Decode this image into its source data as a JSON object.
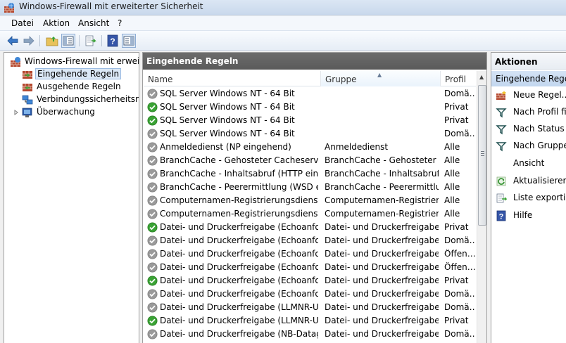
{
  "window": {
    "title": "Windows-Firewall mit erweiterter Sicherheit"
  },
  "menu": [
    "Datei",
    "Aktion",
    "Ansicht",
    "?"
  ],
  "toolbar": [
    "back-icon",
    "forward-icon",
    "up-folder-icon",
    "show-hide-tree-icon",
    "export-list-icon",
    "help-icon",
    "show-hide-action-pane-icon"
  ],
  "tree": {
    "root": "Windows-Firewall mit erweiterter Sicherheit",
    "items": [
      "Eingehende Regeln",
      "Ausgehende Regeln",
      "Verbindungssicherheitsregeln",
      "Überwachung"
    ]
  },
  "center": {
    "header": "Eingehende Regeln",
    "columns": [
      "Name",
      "Gruppe",
      "Profil"
    ],
    "rows": [
      {
        "name": "SQL Server Windows NT - 64 Bit",
        "group": "",
        "profile": "Domä…",
        "enabled": false
      },
      {
        "name": "SQL Server Windows NT - 64 Bit",
        "group": "",
        "profile": "Privat",
        "enabled": true
      },
      {
        "name": "SQL Server Windows NT - 64 Bit",
        "group": "",
        "profile": "Privat",
        "enabled": true
      },
      {
        "name": "SQL Server Windows NT - 64 Bit",
        "group": "",
        "profile": "Domä…",
        "enabled": false
      },
      {
        "name": "Anmeldedienst (NP eingehend)",
        "group": "Anmeldedienst",
        "profile": "Alle",
        "enabled": false
      },
      {
        "name": "BranchCache - Gehosteter Cacheserver (…",
        "group": "BranchCache - Gehosteter C…",
        "profile": "Alle",
        "enabled": false
      },
      {
        "name": "BranchCache - Inhaltsabruf (HTTP einge…",
        "group": "BranchCache - Inhaltsabruf …",
        "profile": "Alle",
        "enabled": false
      },
      {
        "name": "BranchCache - Peerermittlung (WSD ein…",
        "group": "BranchCache - Peerermittlu…",
        "profile": "Alle",
        "enabled": false
      },
      {
        "name": "Computernamen-Registrierungsdienst v…",
        "group": "Computernamen-Registrier…",
        "profile": "Alle",
        "enabled": false
      },
      {
        "name": "Computernamen-Registrierungsdienst v…",
        "group": "Computernamen-Registrier…",
        "profile": "Alle",
        "enabled": false
      },
      {
        "name": "Datei- und Druckerfreigabe (Echoanforde…",
        "group": "Datei- und Druckerfreigabe",
        "profile": "Privat",
        "enabled": true
      },
      {
        "name": "Datei- und Druckerfreigabe (Echoanforde…",
        "group": "Datei- und Druckerfreigabe",
        "profile": "Domä…",
        "enabled": false
      },
      {
        "name": "Datei- und Druckerfreigabe (Echoanforde…",
        "group": "Datei- und Druckerfreigabe",
        "profile": "Öffen…",
        "enabled": false
      },
      {
        "name": "Datei- und Druckerfreigabe (Echoanforde…",
        "group": "Datei- und Druckerfreigabe",
        "profile": "Öffen…",
        "enabled": false
      },
      {
        "name": "Datei- und Druckerfreigabe (Echoanforde…",
        "group": "Datei- und Druckerfreigabe",
        "profile": "Privat",
        "enabled": true
      },
      {
        "name": "Datei- und Druckerfreigabe (Echoanforde…",
        "group": "Datei- und Druckerfreigabe",
        "profile": "Domä…",
        "enabled": false
      },
      {
        "name": "Datei- und Druckerfreigabe (LLMNR-UDP…",
        "group": "Datei- und Druckerfreigabe",
        "profile": "Domä…",
        "enabled": false
      },
      {
        "name": "Datei- und Druckerfreigabe (LLMNR-UDP…",
        "group": "Datei- und Druckerfreigabe",
        "profile": "Privat",
        "enabled": true
      },
      {
        "name": "Datei- und Druckerfreigabe (NB-Datagra…",
        "group": "Datei- und Druckerfreigabe",
        "profile": "Domä…",
        "enabled": false
      }
    ]
  },
  "actions": {
    "header": "Aktionen",
    "section": "Eingehende Regeln",
    "items": [
      {
        "label": "Neue Regel...",
        "icon": "new-rule-icon"
      },
      {
        "label": "Nach Profil filtern",
        "icon": "filter-icon"
      },
      {
        "label": "Nach Status filtern",
        "icon": "filter-icon"
      },
      {
        "label": "Nach Gruppe filtern",
        "icon": "filter-icon"
      },
      {
        "label": "Ansicht",
        "icon": ""
      },
      {
        "label": "Aktualisieren",
        "icon": "refresh-icon"
      },
      {
        "label": "Liste exportieren...",
        "icon": "export-list-icon"
      },
      {
        "label": "Hilfe",
        "icon": "help-icon"
      }
    ]
  },
  "colors": {
    "enabled": "#3aa335",
    "disabled": "#9a9a9a",
    "header_dark": "#626262",
    "selection": "#dbe8f6"
  }
}
